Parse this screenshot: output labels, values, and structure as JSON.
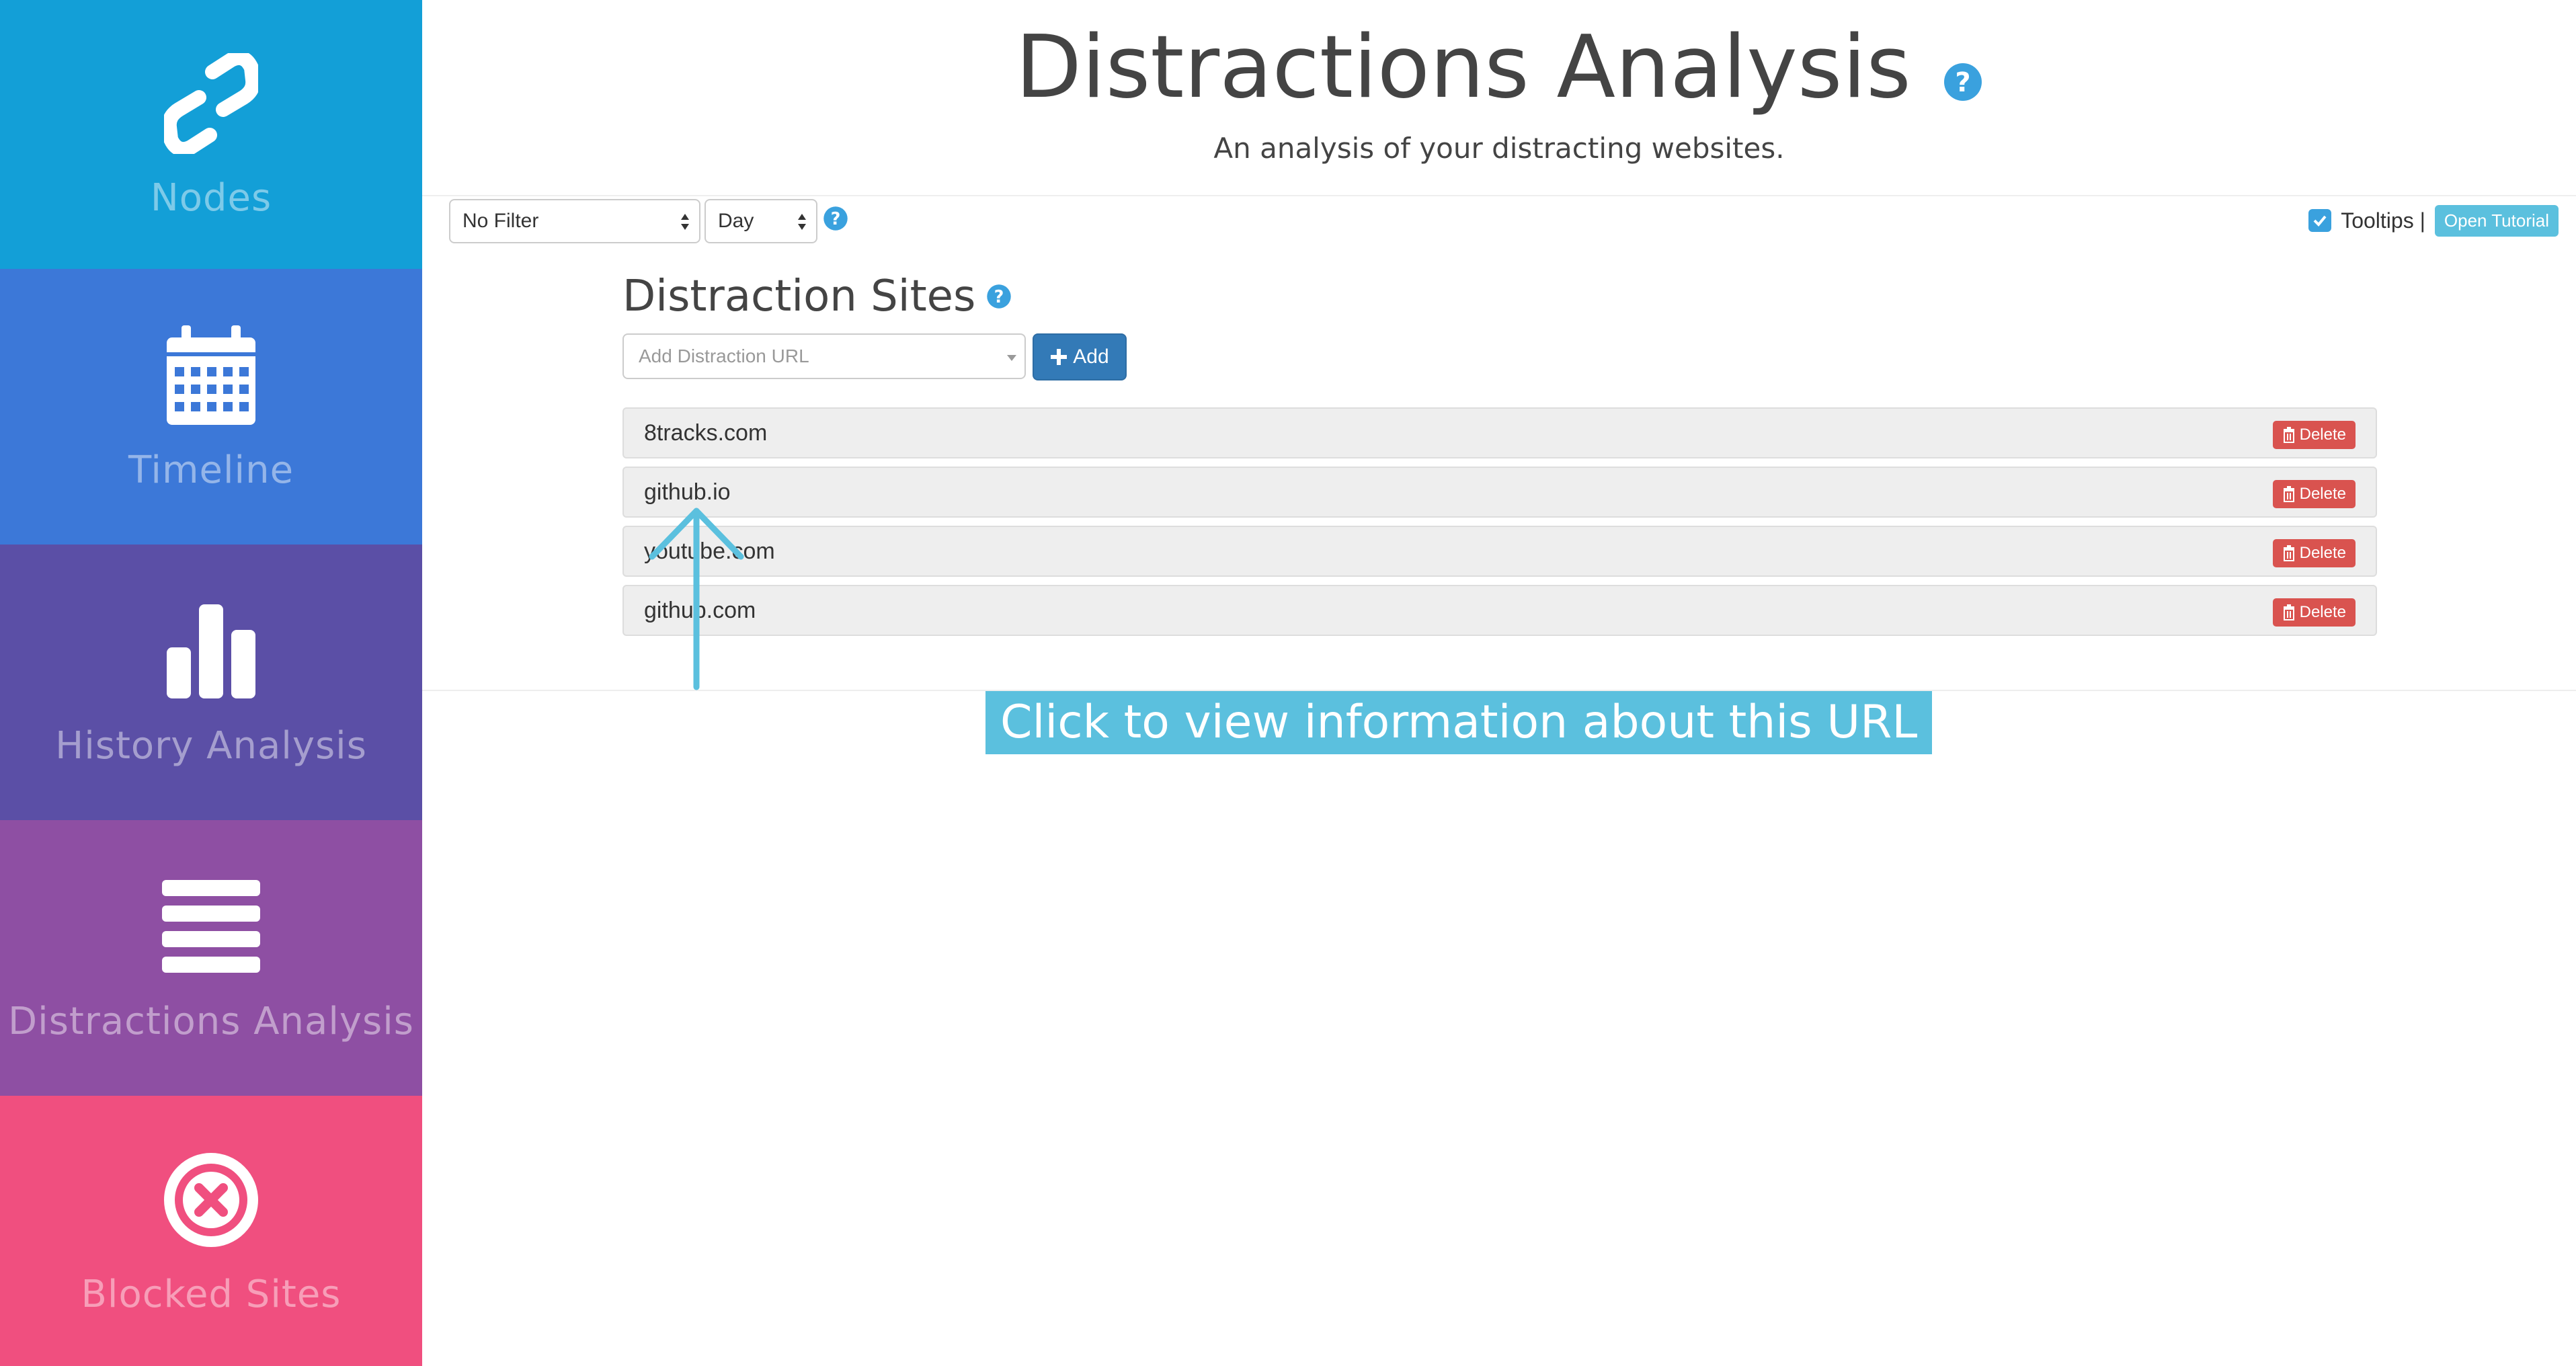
{
  "sidebar": {
    "items": [
      {
        "label": "Nodes",
        "icon": "nodes-link-icon",
        "color": "#139fd7"
      },
      {
        "label": "Timeline",
        "icon": "calendar-icon",
        "color": "#3c78d8"
      },
      {
        "label": "History Analysis",
        "icon": "bar-chart-icon",
        "color": "#5b4fa6"
      },
      {
        "label": "Distractions Analysis",
        "icon": "list-icon",
        "color": "#8e4fa3"
      },
      {
        "label": "Blocked Sites",
        "icon": "close-circle-icon",
        "color": "#f04f7f"
      }
    ]
  },
  "header": {
    "title": "Distractions Analysis",
    "subtitle": "An analysis of your distracting websites."
  },
  "toolbar": {
    "filter_value": "No Filter",
    "period_value": "Day",
    "tooltips_label": "Tooltips |",
    "tooltips_checked": true,
    "tutorial_label": "Open Tutorial"
  },
  "distraction_sites": {
    "title": "Distraction Sites",
    "add_placeholder": "Add Distraction URL",
    "add_label": "Add",
    "delete_label": "Delete",
    "sites": [
      "8tracks.com",
      "github.io",
      "youtube.com",
      "github.com"
    ]
  },
  "tooltip": {
    "text": "Click to view information about this URL"
  },
  "colors": {
    "accent": "#5bc0de",
    "primary": "#337ab7",
    "danger": "#d9534f"
  }
}
